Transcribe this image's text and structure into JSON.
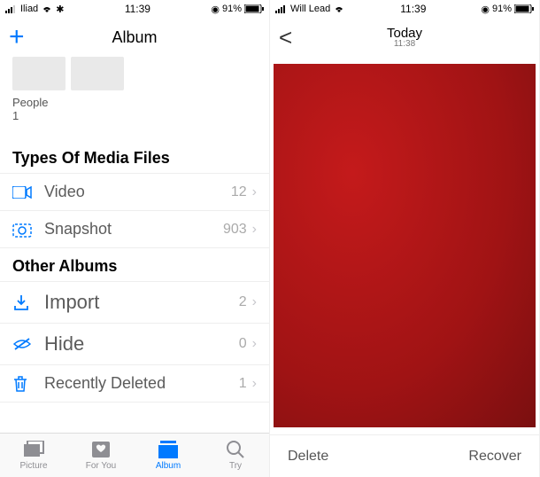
{
  "left": {
    "status": {
      "carrier": "Iliad",
      "time": "11:39",
      "battery": "91%"
    },
    "nav": {
      "title": "Album"
    },
    "people": {
      "label": "People",
      "count": "1"
    },
    "sections": {
      "media": {
        "header": "Types Of Media Files",
        "video": {
          "label": "Video",
          "count": "12"
        },
        "snapshot": {
          "label": "Snapshot",
          "count": "903"
        }
      },
      "other": {
        "header": "Other Albums",
        "import": {
          "label": "Import",
          "count": "2"
        },
        "hide": {
          "label": "Hide",
          "count": "0"
        },
        "deleted": {
          "label": "Recently Deleted",
          "count": "1"
        }
      }
    },
    "tabs": {
      "picture": "Picture",
      "foryou": "For You",
      "album": "Album",
      "try": "Try"
    }
  },
  "right": {
    "status": {
      "carrier": "Will Lead",
      "time": "11:39",
      "battery": "91%"
    },
    "nav": {
      "title": "Today",
      "subtitle": "11:38"
    },
    "actions": {
      "delete": "Delete",
      "recover": "Recover"
    }
  }
}
